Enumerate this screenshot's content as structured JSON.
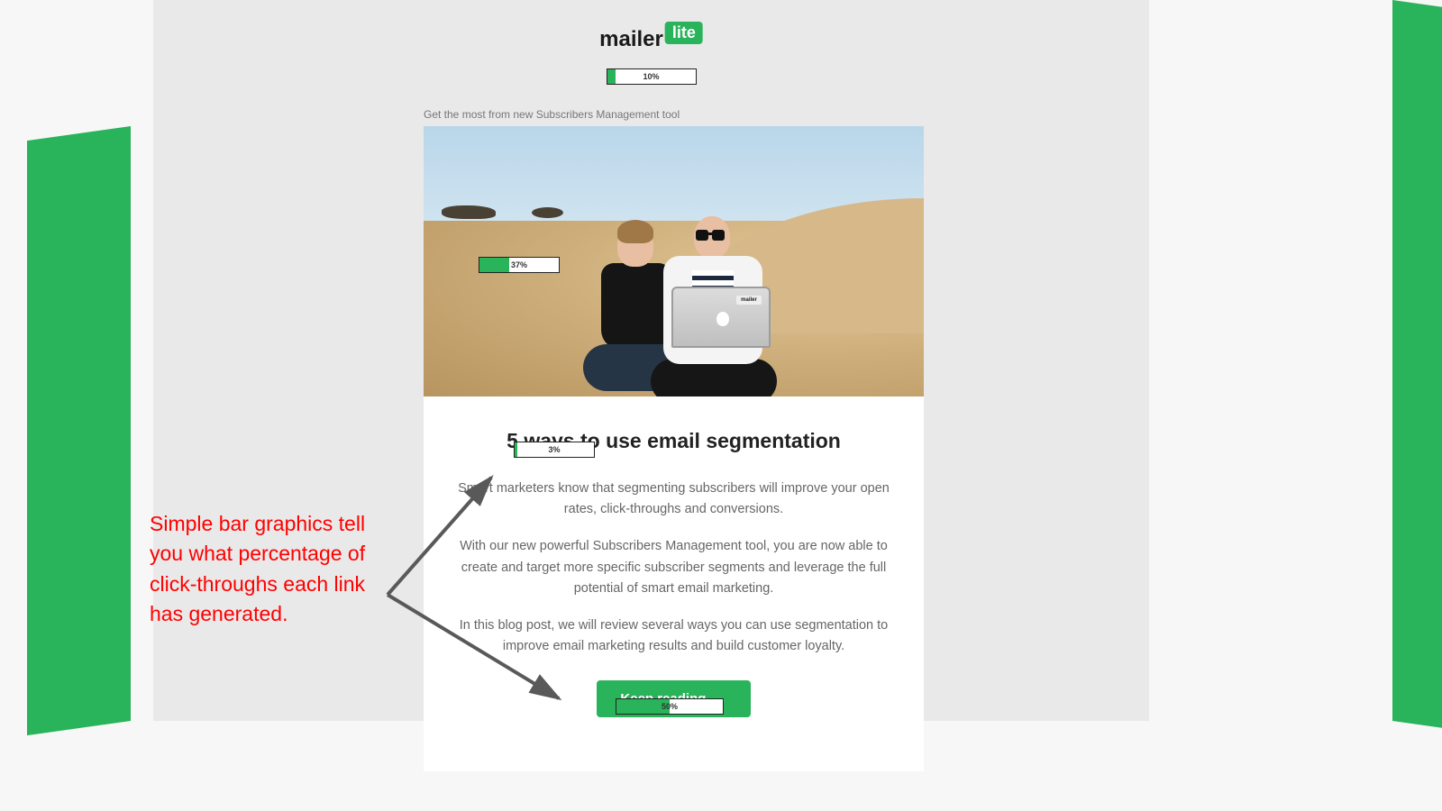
{
  "logo": {
    "main": "mailer",
    "accent": "lite"
  },
  "subhead": "Get the most from new Subscribers Management tool",
  "progress": {
    "logo": {
      "pct": 10,
      "label": "10%"
    },
    "image": {
      "pct": 37,
      "label": "37%"
    },
    "title": {
      "pct": 3,
      "label": "3%"
    },
    "cta": {
      "pct": 50,
      "label": "50%"
    }
  },
  "article": {
    "heading": "5 ways to use email segmentation",
    "p1": "Smart marketers know that segmenting subscribers will improve your open rates, click-throughs and conversions.",
    "p2": "With our new powerful Subscribers Management tool, you are now able to create and target more specific subscriber segments and leverage the full potential of smart email marketing.",
    "p3": "In this blog post, we will review several ways you can use segmentation to improve email marketing results and build customer loyalty.",
    "cta": "Keep reading",
    "cta_arrow": "→"
  },
  "sticker": "mailer",
  "callout": "Simple bar graphics tell you what percentage of click-throughs each link has generated.",
  "colors": {
    "brand": "#29b35a",
    "annotation": "#ff0000",
    "arrow": "#595959"
  }
}
